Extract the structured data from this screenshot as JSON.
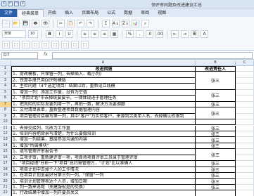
{
  "app": {
    "title": "领评审问题及改进建议汇总",
    "qat": [
      "X",
      "↶",
      "↷",
      "▾"
    ]
  },
  "tabs": [
    "文件",
    "经典菜单",
    "开始",
    "插入",
    "页面布局",
    "公式",
    "数据",
    "审阅",
    "视图"
  ],
  "ribbon": {
    "font_name": "宋体",
    "font_size": "10",
    "row1": [
      "📄",
      "📂",
      "💾",
      "🖶",
      "👁",
      "✂",
      "📋",
      "↶",
      "↷",
      "Σ",
      "A↓",
      "Z↓",
      "📊",
      "⌕"
    ],
    "row2": [
      "B",
      "I",
      "U",
      "≡",
      "≡",
      "≡",
      "▦",
      "%",
      ",",
      ".0",
      ".00",
      "⇤",
      "⇥",
      "田",
      "A"
    ],
    "row3": [
      "⬚",
      "⬚",
      "⬚",
      "⬚",
      "⬚",
      "⬚",
      "⬚",
      "⬚",
      "⬚"
    ]
  },
  "formula_bar": {
    "name_box": "D7",
    "fx": "fx",
    "content": ""
  },
  "columns": [
    "A",
    "B",
    "C"
  ],
  "rows": [
    {
      "num": "1",
      "a": "改进措施",
      "b": "改进责任人"
    },
    {
      "num": "2",
      "a": "1、提改模板，只保留一列，去掉插入、截小列)",
      "b": ""
    },
    {
      "num": "3",
      "a": "2、铁算手册只用DEP附模版",
      "b": ""
    },
    {
      "num": "4",
      "a": "3、主检问题（4个选定项目）结果以后，重新设立线模",
      "b": ""
    },
    {
      "num": "5",
      "a": "1、增加一列：添加工作量，没有为空值",
      "b": ""
    },
    {
      "num": "6",
      "a": "2、\"项目计划\"中去掉统要要节，一律体现进于管理任务",
      "b": ""
    },
    {
      "num": "7",
      "a": "1、把风险的实际发要列增一下，再拍一数，解决方法要调额",
      "b": ""
    },
    {
      "num": "8",
      "a": "1、文付清单表单，重新整理项目数据管理内容",
      "b": ""
    },
    {
      "num": "9",
      "a": "2、项目管理对接编写第一列，其中\"客户\"为实验客户，来源到另类单人名，去掉确认权限到",
      "b": ""
    },
    {
      "num": "10",
      "a": "",
      "b": ""
    },
    {
      "num": "11",
      "a": "1、去掉交接列，均改为工作量",
      "b": ""
    },
    {
      "num": "12",
      "a": "1、培训内容把背景写清楚，为什么要做培训",
      "b": ""
    },
    {
      "num": "13",
      "a": "1、增加一列结果，基层参加沟通的内容",
      "b": ""
    },
    {
      "num": "14",
      "a": "1、增加\"所属模块\"",
      "b": ""
    },
    {
      "num": "15",
      "a": "1、填写管理评审报告书",
      "b": ""
    },
    {
      "num": "16",
      "a": "2、立项评审，重新建评审一项，项目场项目评审三员属于管理评审",
      "b": ""
    },
    {
      "num": "17",
      "a": "1、\"项目经理\"分析一下\"项目\"总约需管理方，\"计划\"比以准确人",
      "b": ""
    },
    {
      "num": "18",
      "a": "1、项目计划中去掉个人的工作情况",
      "b": ""
    },
    {
      "num": "19",
      "a": "1、在项目计划里最好分第三列一列，\"保留\"一列",
      "b": ""
    },
    {
      "num": "20",
      "a": "1、培训计划管理表达个人员，增加日期",
      "b": ""
    },
    {
      "num": "21",
      "a": "1、列一数来说呢（关建服役是的交换）",
      "b": ""
    },
    {
      "num": "22",
      "a": "1、行改结果中增加一列开要员关文",
      "b": ""
    }
  ],
  "assignees": [
    {
      "label": "张三",
      "start": 1,
      "span": 3
    },
    {
      "label": "张三",
      "start": 4,
      "span": 2
    },
    {
      "label": "张三",
      "start": 6,
      "span": 1
    },
    {
      "label": "张三",
      "start": 7,
      "span": 2
    },
    {
      "label": "张三",
      "start": 10,
      "span": 1
    },
    {
      "label": "张三",
      "start": 11,
      "span": 1
    },
    {
      "label": "张三",
      "start": 12,
      "span": 1
    },
    {
      "label": "张三",
      "start": 13,
      "span": 1
    },
    {
      "label": "张三",
      "start": 14,
      "span": 2
    },
    {
      "label": "张三",
      "start": 16,
      "span": 1
    },
    {
      "label": "张三",
      "start": 17,
      "span": 1
    },
    {
      "label": "张三",
      "start": 18,
      "span": 1
    },
    {
      "label": "张三",
      "start": 19,
      "span": 1
    },
    {
      "label": "张三",
      "start": 20,
      "span": 1
    }
  ],
  "selected_row": "7",
  "colors": {
    "file_tab": "#2a5ea8",
    "header_bg": "#e4ecf7",
    "selected_row_header": "#f6d48a"
  }
}
